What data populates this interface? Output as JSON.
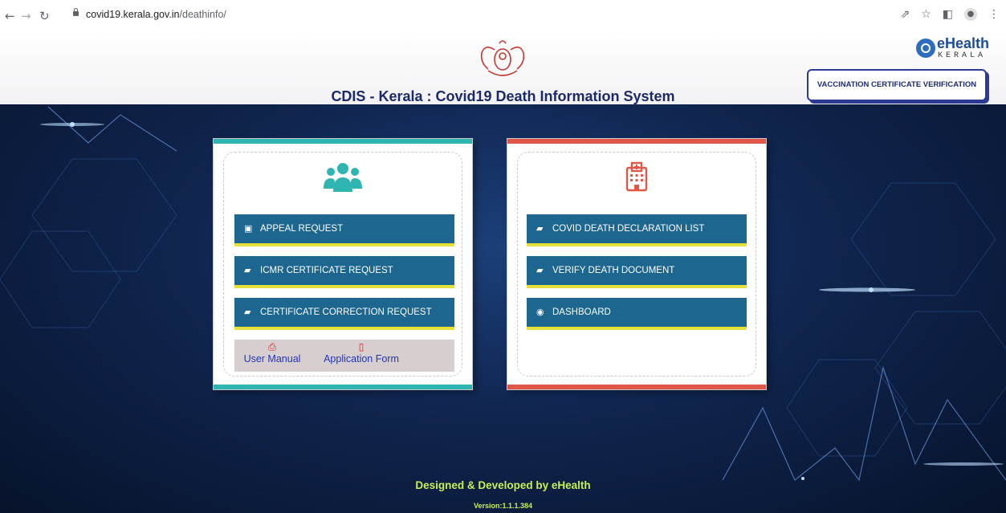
{
  "browser": {
    "url_domain": "covid19.kerala.gov.in",
    "url_path": "/deathinfo/"
  },
  "header": {
    "title": "CDIS - Kerala : Covid19 Death Information System",
    "logo_text": "eHealth",
    "logo_subtext": "KERALA",
    "vaccination_button": "VACCINATION CERTIFICATE VERIFICATION"
  },
  "left_card": {
    "icon": "users-icon",
    "accent": "#2fb5b1",
    "buttons": [
      {
        "label": "APPEAL REQUEST",
        "icon": "edit-document-icon"
      },
      {
        "label": "ICMR CERTIFICATE REQUEST",
        "icon": "book-icon"
      },
      {
        "label": "CERTIFICATE CORRECTION REQUEST",
        "icon": "book-icon"
      }
    ],
    "downloads": [
      {
        "label": "User Manual",
        "icon": "pdf-icon"
      },
      {
        "label": "Application Form",
        "icon": "file-icon"
      }
    ]
  },
  "right_card": {
    "icon": "hospital-icon",
    "accent": "#e0574a",
    "buttons": [
      {
        "label": "COVID DEATH DECLARATION LIST",
        "icon": "book-icon"
      },
      {
        "label": "VERIFY DEATH DOCUMENT",
        "icon": "book-icon"
      },
      {
        "label": "DASHBOARD",
        "icon": "dashboard-icon"
      }
    ]
  },
  "footer": {
    "credit": "Designed & Developed by eHealth",
    "version": "Version:1.1.1.384"
  },
  "colors": {
    "button_bg": "#1c6690",
    "button_underline": "#e6e13a",
    "footer_text": "#c8ef55",
    "title_text": "#1c2a6b"
  }
}
